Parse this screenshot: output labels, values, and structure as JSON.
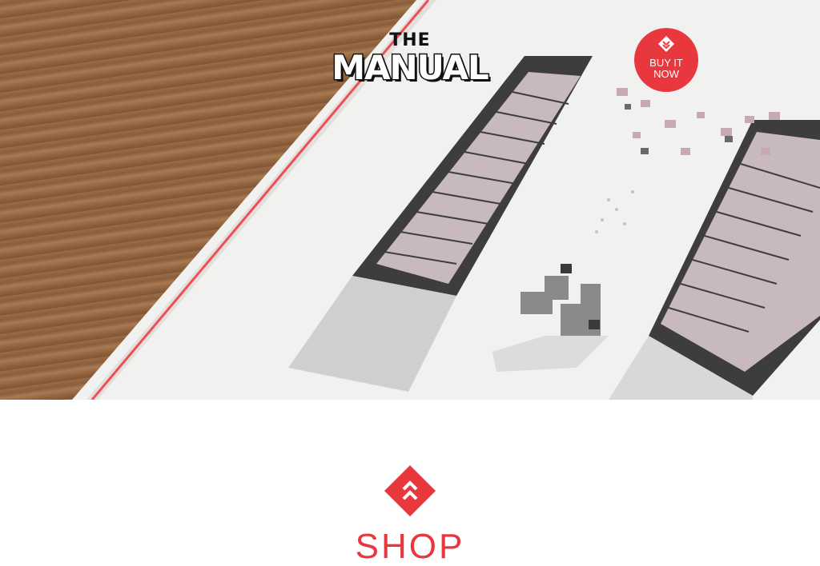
{
  "logo": {
    "line1": "THE",
    "line2": "MANUAL"
  },
  "buy_button": {
    "line1": "BUY IT",
    "line2": "NOW",
    "icon": "chevron-down-diamond-icon"
  },
  "shop": {
    "title": "SHOP",
    "icon": "chevron-up-diamond-icon"
  },
  "colors": {
    "accent": "#e8383e",
    "text_dark": "#111111",
    "background": "#ffffff"
  }
}
